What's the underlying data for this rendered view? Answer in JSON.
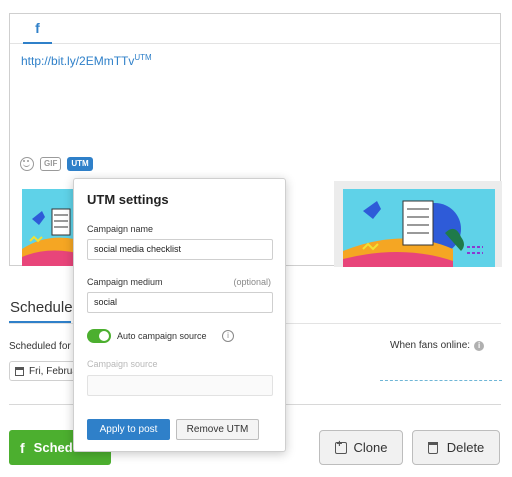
{
  "composer": {
    "tab_icon": "facebook-icon",
    "tab_glyph": "f",
    "link_text": "http://bit.ly/2EMmTTv",
    "link_sup": "UTM",
    "tools": {
      "emoji_icon": "smiley-icon",
      "gif_label": "GIF",
      "utm_label": "UTM"
    }
  },
  "schedule_section": {
    "tab_label": "Schedule",
    "scheduled_for_label": "Scheduled for",
    "date_value": "Fri, February",
    "fans_online_label": "When fans online:"
  },
  "actions": {
    "schedule_label": "Schedule",
    "clone_label": "Clone",
    "delete_label": "Delete"
  },
  "utm_popup": {
    "title": "UTM settings",
    "campaign_name_label": "Campaign name",
    "campaign_name_value": "social media checklist",
    "campaign_medium_label": "Campaign medium",
    "campaign_medium_optional": "(optional)",
    "campaign_medium_value": "social",
    "auto_source_label": "Auto campaign source",
    "auto_source_on": true,
    "campaign_source_label": "Campaign source",
    "campaign_source_value": "",
    "apply_label": "Apply to post",
    "remove_label": "Remove UTM"
  },
  "colors": {
    "accent_blue": "#2f80c9",
    "green": "#4caf2f"
  }
}
